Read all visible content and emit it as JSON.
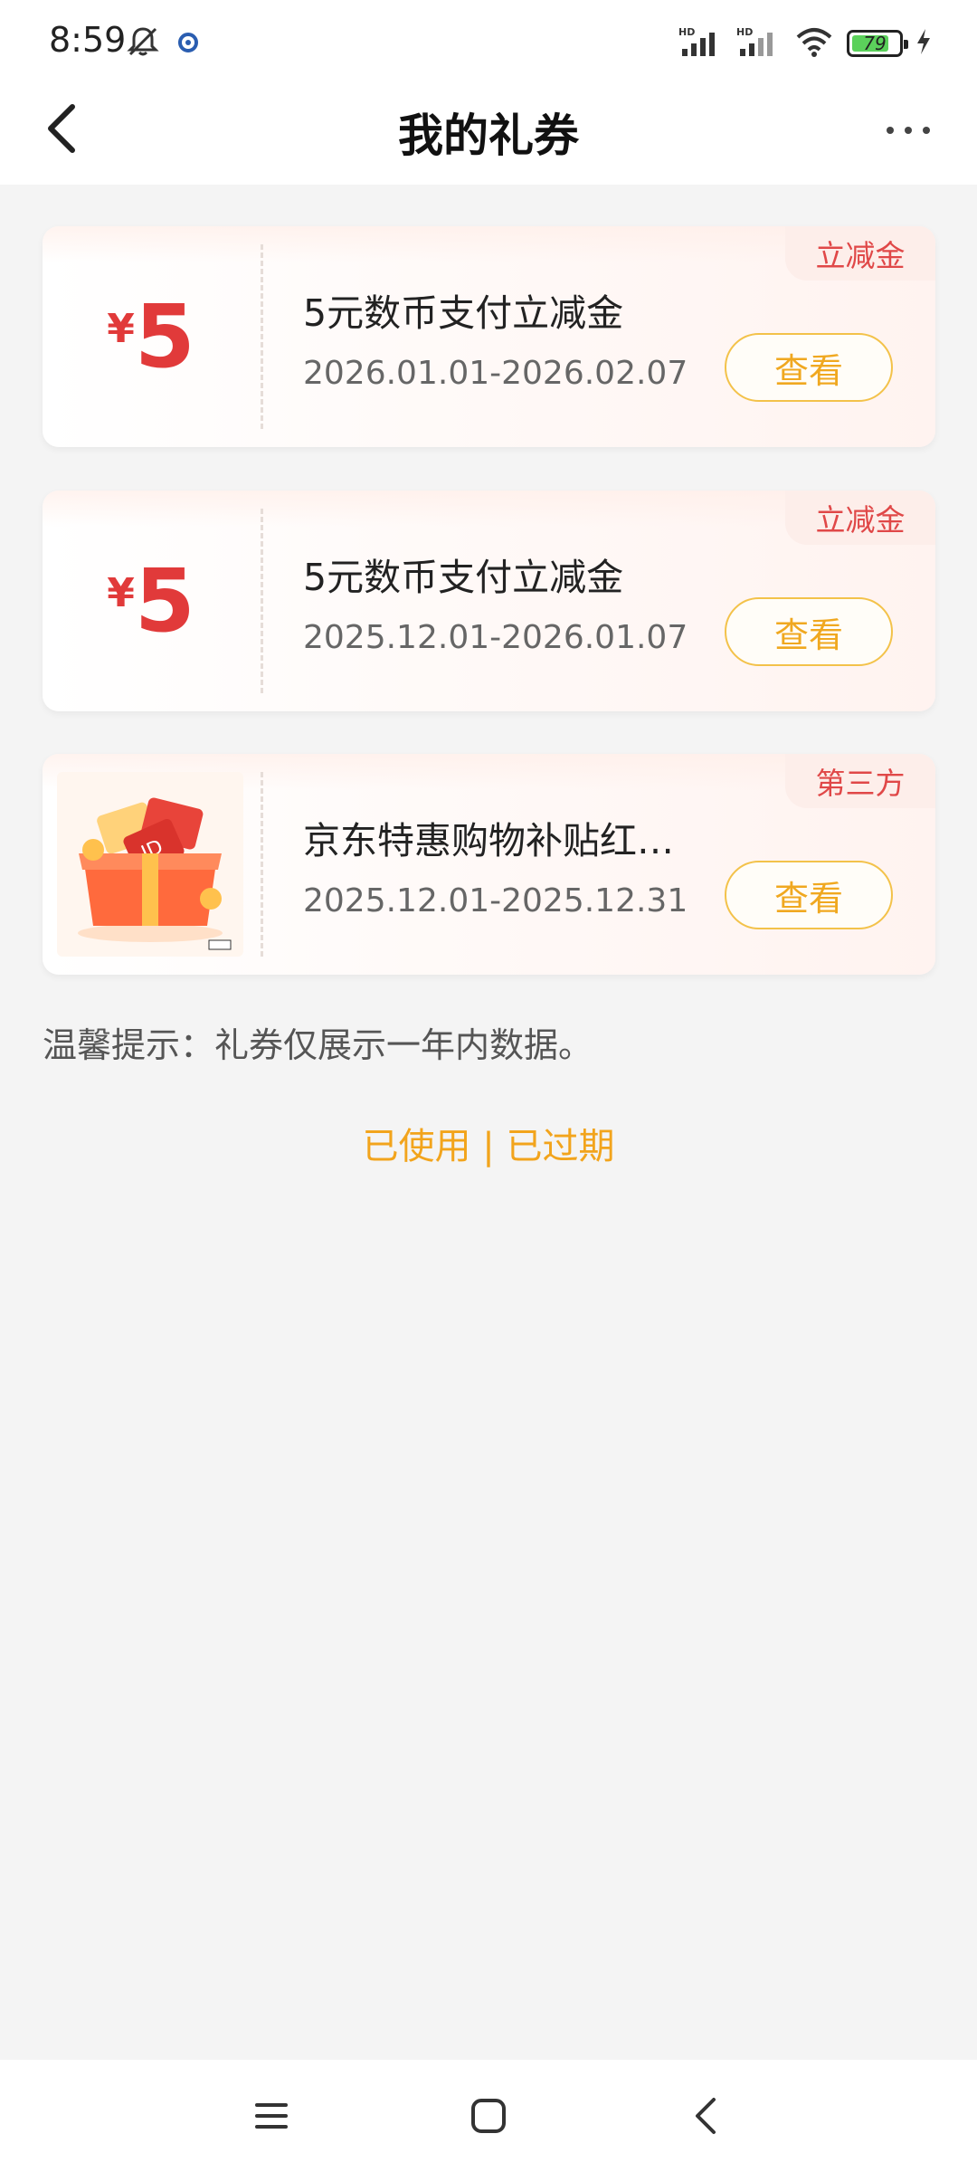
{
  "status_bar": {
    "time": "8:59",
    "battery_level": "79",
    "battery_fraction": 0.79,
    "icons": [
      "mute-icon",
      "app-notification-icon",
      "hd-signal-icon",
      "hd-signal-icon",
      "wifi-icon",
      "battery-icon",
      "charging-icon"
    ]
  },
  "header": {
    "title": "我的礼券",
    "back_icon": "chevron-left-icon",
    "more_icon": "more-icon"
  },
  "coupons": [
    {
      "badge": "立减金",
      "currency": "¥",
      "amount": "5",
      "title": "5元数币支付立减金",
      "date_range": "2026.01.01-2026.02.07",
      "action": "查看"
    },
    {
      "badge": "立减金",
      "currency": "¥",
      "amount": "5",
      "title": "5元数币支付立减金",
      "date_range": "2025.12.01-2026.01.07",
      "action": "查看"
    },
    {
      "badge": "第三方",
      "image": "gift-box-icon",
      "title": "京东特惠购物补贴红…",
      "date_range": "2025.12.01-2025.12.31",
      "action": "查看"
    }
  ],
  "tip": "温馨提示：礼券仅展示一年内数据。",
  "links": {
    "used": "已使用",
    "separator": "|",
    "expired": "已过期"
  },
  "colors": {
    "accent_red": "#e13a3a",
    "accent_orange": "#f2a41c",
    "background": "#f4f4f4"
  }
}
